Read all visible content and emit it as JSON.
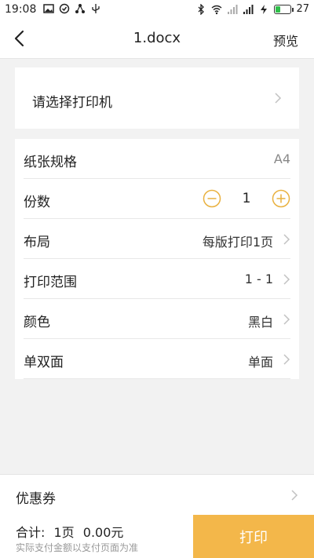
{
  "status_bar": {
    "time": "19:08",
    "battery_level": "27",
    "icons_left": [
      "image-icon",
      "check-circle-icon",
      "share-icon",
      "usb-icon"
    ],
    "icons_right": [
      "bluetooth-icon",
      "wifi-icon",
      "signal-icon",
      "signal-icon",
      "charging-icon",
      "battery-icon"
    ]
  },
  "navbar": {
    "title": "1.docx",
    "preview_label": "预览"
  },
  "printer": {
    "label": "请选择打印机"
  },
  "settings": {
    "paper": {
      "label": "纸张规格",
      "value": "A4"
    },
    "copies": {
      "label": "份数",
      "value": "1"
    },
    "layout": {
      "label": "布局",
      "value": "每版打印1页"
    },
    "range": {
      "label": "打印范围",
      "value": "1 - 1"
    },
    "color": {
      "label": "颜色",
      "value": "黑白"
    },
    "duplex": {
      "label": "单双面",
      "value": "单面"
    }
  },
  "coupon": {
    "label": "优惠券"
  },
  "footer": {
    "total_label": "合计:",
    "pages": "1页",
    "amount": "0.00元",
    "note": "实际支付金额以支付页面为准",
    "print_label": "打印"
  },
  "colors": {
    "accent": "#f3b74a",
    "stepper": "#e9b13f"
  }
}
